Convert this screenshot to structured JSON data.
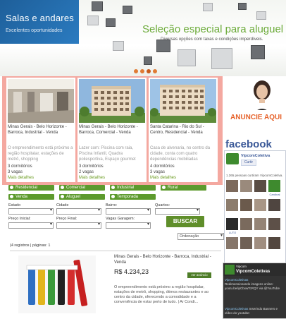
{
  "banner": {
    "box_title": "Salas e andares",
    "box_subtitle": "Excelentes oportunidades",
    "headline": "Seleção especial para aluguel",
    "subheadline": "Diversas opções com taxas e condições imperdíveis.",
    "slide_count": 4
  },
  "listings": [
    {
      "title": "Minas Gerais - Belo Horizonte - Barroca, Industrial - Venda",
      "desc": "O empreendimento está próximo a região hospitalar, estações de metrô, shopping",
      "rooms": "3 dormitórios",
      "spaces": "3 vagas",
      "link": "Mais detalhes"
    },
    {
      "title": "Minas Gerais - Belo Horizonte - Barroca, Comercial - Venda",
      "desc": "Lazer com: Piscina com raia, Piscina Infantil, Quadra poliesportiva, Espaço gourmet",
      "rooms": "3 dormitórios",
      "spaces": "2 vagas",
      "link": "Mais detalhes"
    },
    {
      "title": "Santa Catarina - Rio do Sul - Centro, Residencial - Venda",
      "desc": "Casa de alvenaria, no centro da cidade, conta com quatro dependências mobiliadas",
      "rooms": "4 dormitórios",
      "spaces": "3 vagas",
      "link": "Mais detalhes"
    }
  ],
  "ad": {
    "text": "ANUNCIE AQUI"
  },
  "facebook": {
    "title": "facebook",
    "page_name": "VipcomColetiva",
    "like_label": "Curtir",
    "count_text": "1.265 pessoas curtiram VipcomColetiva.",
    "faces": [
      "",
      "",
      "",
      "Cardinal",
      "",
      "",
      "",
      "",
      "LUTO",
      "",
      "",
      "",
      "",
      "",
      "",
      ""
    ]
  },
  "search": {
    "types": [
      "Residencial",
      "Comercial",
      "Industrial",
      "Rural"
    ],
    "modes": [
      "Venda",
      "Aluguel",
      "Temporada"
    ],
    "labels": {
      "estado": "Estado",
      "cidade": "Cidade",
      "bairro": "Bairro:",
      "quartos": "Quartos:",
      "preco_inicial": "Preço Inicial:",
      "preco_final": "Preço Final:",
      "vagas": "Vagas Garagem:"
    },
    "button": "BUSCAR",
    "order": "Ordenação"
  },
  "results": {
    "summary": "(4 registros | páginas:  1",
    "item": {
      "title": "Minas Gerais - Belo Horizonte - Barroca, Industrial - Venda",
      "price": "R$ 4.234,23",
      "button": "ver anúncio",
      "desc": "O empreendimento está próximo a região hospitalar, estações de metrô, shopping, ótimos restaurantes e ao centro da cidade, oferecendo a comodidade e a conveniência de estar perto de tudo.  | Ar Condi..."
    }
  },
  "twitter": {
    "label": "Vipcom",
    "name": "VipcomColetivas",
    "tweets": [
      {
        "user": "VipcomColetivas",
        "text": "Redimensionando imagens online: youtu.be/ipCbxwTcRQY via @YouTube"
      },
      {
        "user": "VipcomColetivas",
        "text": "Inserindo Banners e vídeo do youtube:"
      }
    ]
  }
}
